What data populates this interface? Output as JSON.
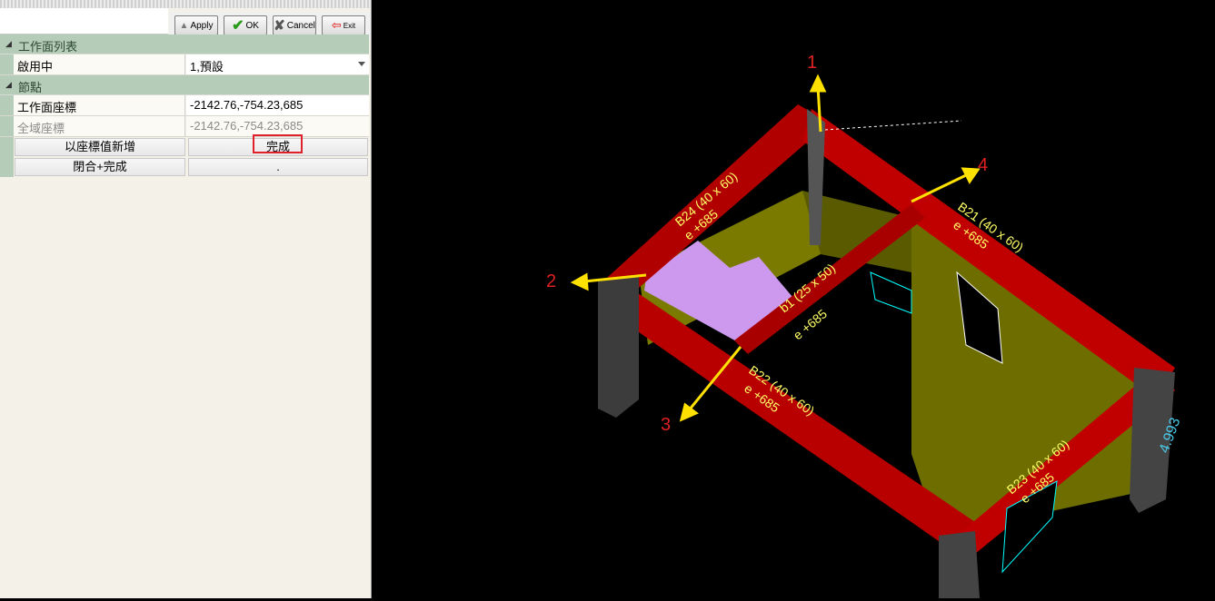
{
  "toolbar": {
    "apply_label": "Apply",
    "ok_label": "OK",
    "cancel_label": "Cancel",
    "exit_label": "Exit"
  },
  "properties": {
    "section1": "工作面列表",
    "active_label": "啟用中",
    "active_value": "1,預設",
    "section2": "節點",
    "workplane_coord_label": "工作面座標",
    "workplane_coord_value": "-2142.76,-754.23,685",
    "global_coord_label": "全域座標",
    "global_coord_value": "-2142.76,-754.23,685",
    "add_by_coord_button": "以座標值新增",
    "finish_button": "完成",
    "close_finish_button": "閉合+完成",
    "dot_button": "."
  },
  "scene": {
    "arrow_labels": [
      "1",
      "2",
      "3",
      "4"
    ],
    "beam_labels": [
      "B24 (40 x 60)",
      "e +685",
      "B21 (40 x 60)",
      "e +685",
      "B22 (40 x 60)",
      "e +685",
      "B23 (40 x 60)",
      "e +685",
      "b1 (25 x 50)",
      "e +685"
    ],
    "value_label": "4.993",
    "colors": {
      "beam": "#c00000",
      "wall": "#7a7a00",
      "column": "#5a5a5a",
      "slab": "#cc99ee",
      "arrow": "#ffe100",
      "arrow_label": "#e02020",
      "beam_text": "#ffff66"
    }
  }
}
